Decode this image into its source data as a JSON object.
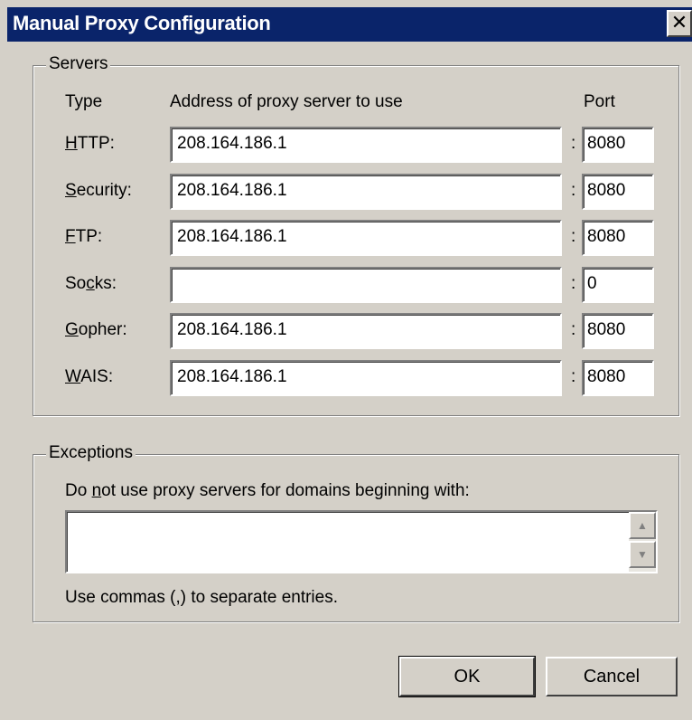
{
  "window": {
    "title": "Manual Proxy Configuration",
    "close_glyph": "✕"
  },
  "servers": {
    "group_label": "Servers",
    "headers": {
      "type": "Type",
      "address": "Address of proxy server to use",
      "port": "Port"
    },
    "colon": ":",
    "rows": [
      {
        "label_pre": "",
        "label_key": "H",
        "label_post": "TTP:",
        "address": "208.164.186.1",
        "port": "8080"
      },
      {
        "label_pre": "",
        "label_key": "S",
        "label_post": "ecurity:",
        "address": "208.164.186.1",
        "port": "8080"
      },
      {
        "label_pre": "",
        "label_key": "F",
        "label_post": "TP:",
        "address": "208.164.186.1",
        "port": "8080"
      },
      {
        "label_pre": "So",
        "label_key": "c",
        "label_post": "ks:",
        "address": "",
        "port": "0"
      },
      {
        "label_pre": "",
        "label_key": "G",
        "label_post": "opher:",
        "address": "208.164.186.1",
        "port": "8080"
      },
      {
        "label_pre": "",
        "label_key": "W",
        "label_post": "AIS:",
        "address": "208.164.186.1",
        "port": "8080"
      }
    ]
  },
  "exceptions": {
    "group_label": "Exceptions",
    "prompt_pre": "Do ",
    "prompt_key": "n",
    "prompt_post": "ot use proxy servers for domains beginning with:",
    "value": "",
    "hint": "Use commas (,) to separate entries.",
    "scroll_up_glyph": "▲",
    "scroll_down_glyph": "▼"
  },
  "buttons": {
    "ok": "OK",
    "cancel": "Cancel"
  }
}
